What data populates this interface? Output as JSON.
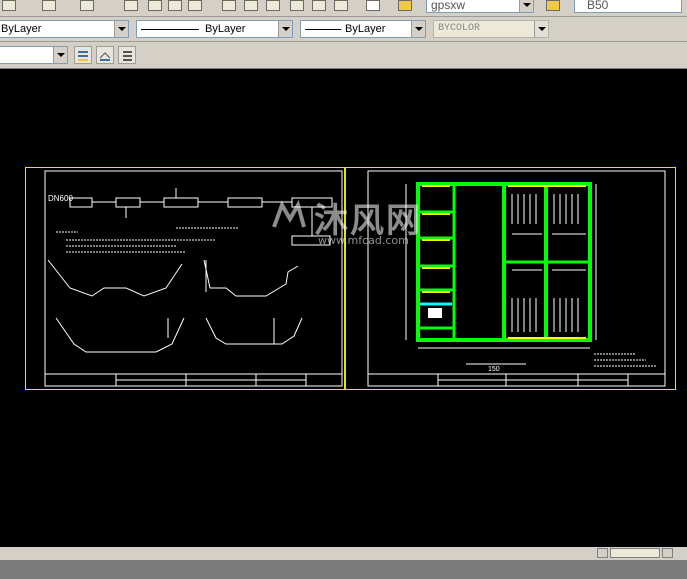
{
  "toolbar_top": {
    "text_style_value": "gpsxw",
    "dim_style_value": "B50"
  },
  "properties": {
    "layer_color": "ByLayer",
    "linetype": "ByLayer",
    "lineweight": "ByLayer",
    "plot_style": "BYCOLOR"
  },
  "watermark": {
    "brand": "沐风网",
    "url": "www.mfcad.com"
  },
  "drawing": {
    "left_sheet_labels": [
      "DN600"
    ],
    "right_sheet_labels": [
      "150"
    ]
  },
  "colors": {
    "background": "#000000",
    "sheet_border": "#e6e600",
    "wall_green": "#00ff00",
    "accent_yellow": "#ffff00",
    "accent_cyan": "#00ffff",
    "line_white": "#ffffff"
  }
}
